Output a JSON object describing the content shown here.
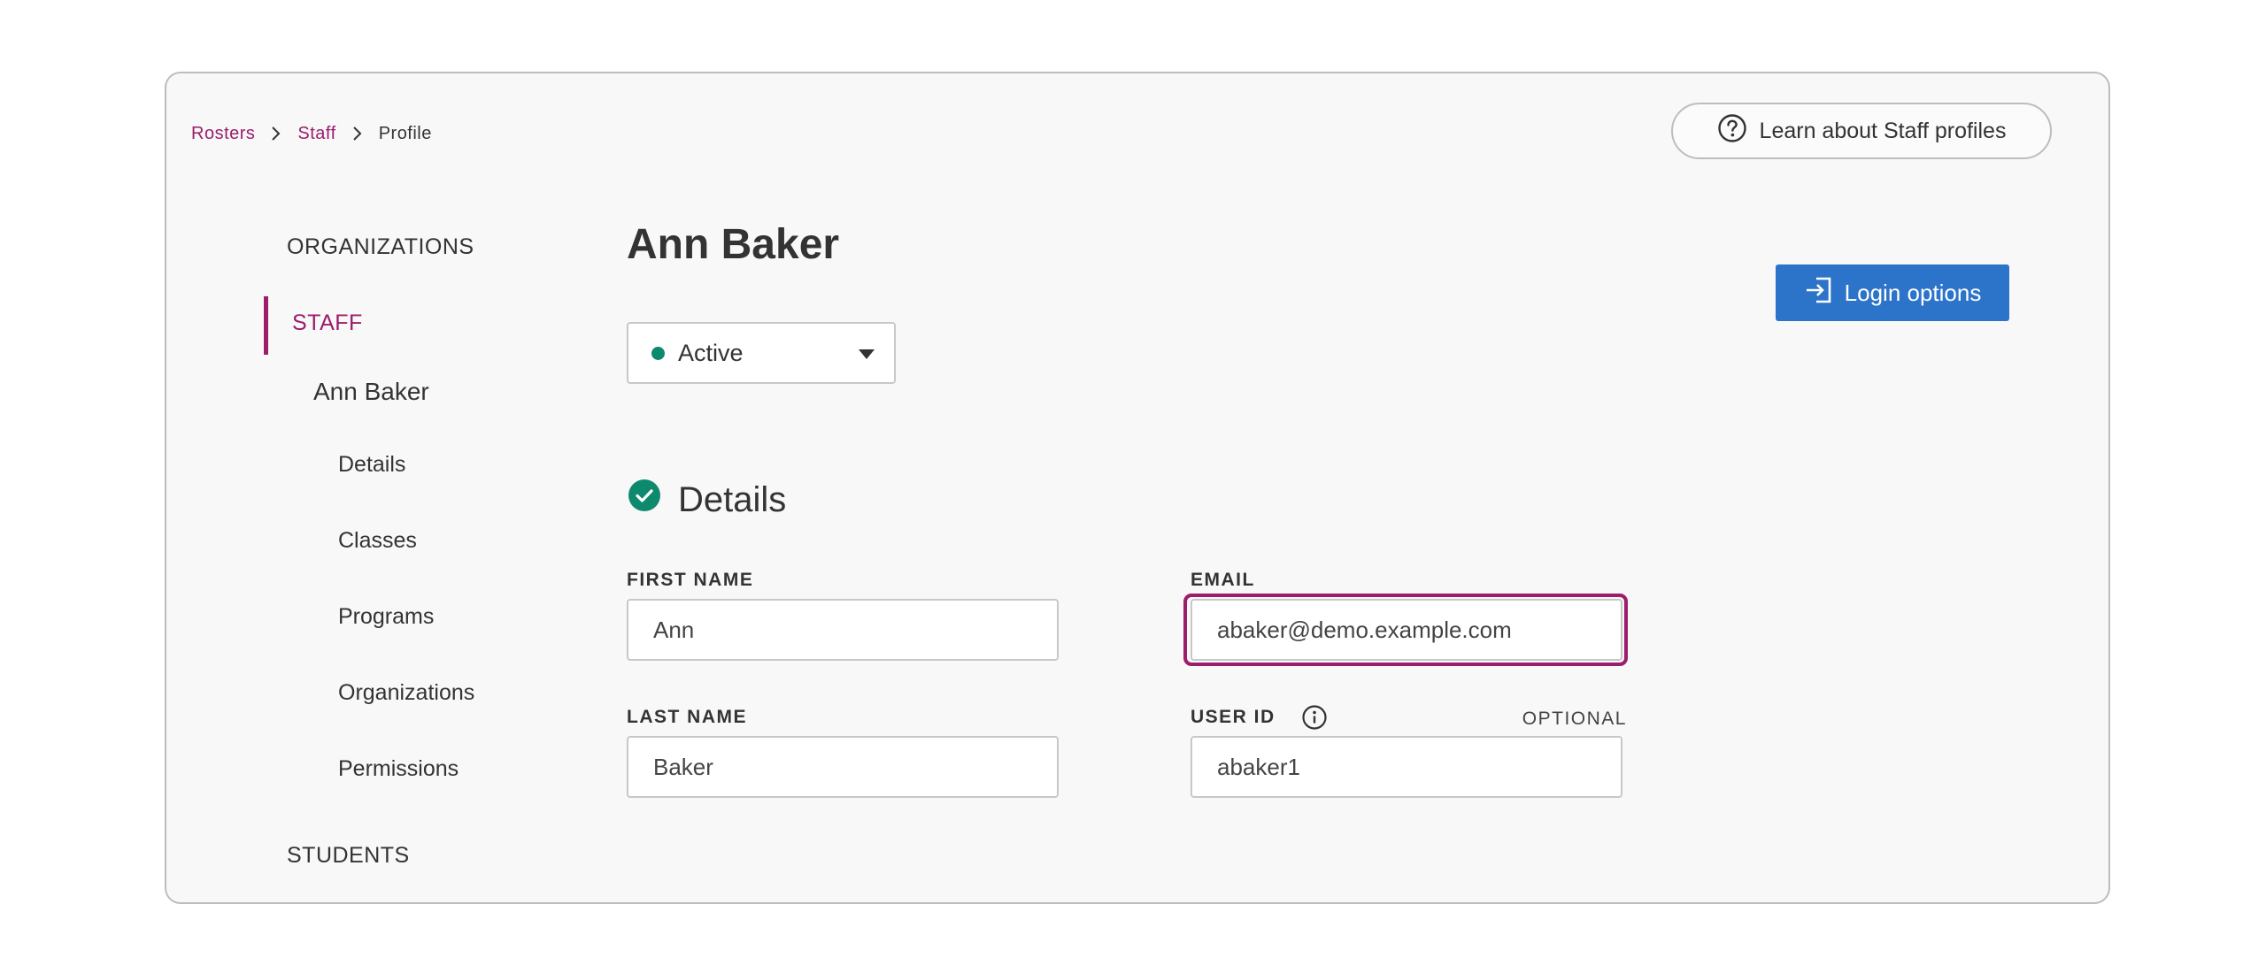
{
  "breadcrumb": {
    "items": [
      {
        "label": "Rosters"
      },
      {
        "label": "Staff"
      },
      {
        "label": "Profile"
      }
    ]
  },
  "help_button": {
    "label": "Learn about Staff profiles",
    "icon": "question-circle-icon"
  },
  "sidebar": {
    "organizations": "ORGANIZATIONS",
    "staff": "STAFF",
    "person": "Ann Baker",
    "subitems": [
      "Details",
      "Classes",
      "Programs",
      "Organizations",
      "Permissions"
    ],
    "students": "STUDENTS"
  },
  "profile": {
    "name": "Ann Baker",
    "status": "Active",
    "status_color": "#0d8a6e"
  },
  "details": {
    "heading": "Details",
    "first_name_label": "FIRST NAME",
    "first_name": "Ann",
    "last_name_label": "LAST NAME",
    "last_name": "Baker",
    "email_label": "EMAIL",
    "email": "abaker@demo.example.com",
    "user_id_label": "USER ID",
    "user_id": "abaker1",
    "optional": "OPTIONAL"
  },
  "login_button": {
    "label": "Login options",
    "icon": "sign-in-icon"
  },
  "colors": {
    "accent": "#9b1d6b",
    "primary_button": "#2c74c9",
    "success": "#0d8a6e"
  }
}
